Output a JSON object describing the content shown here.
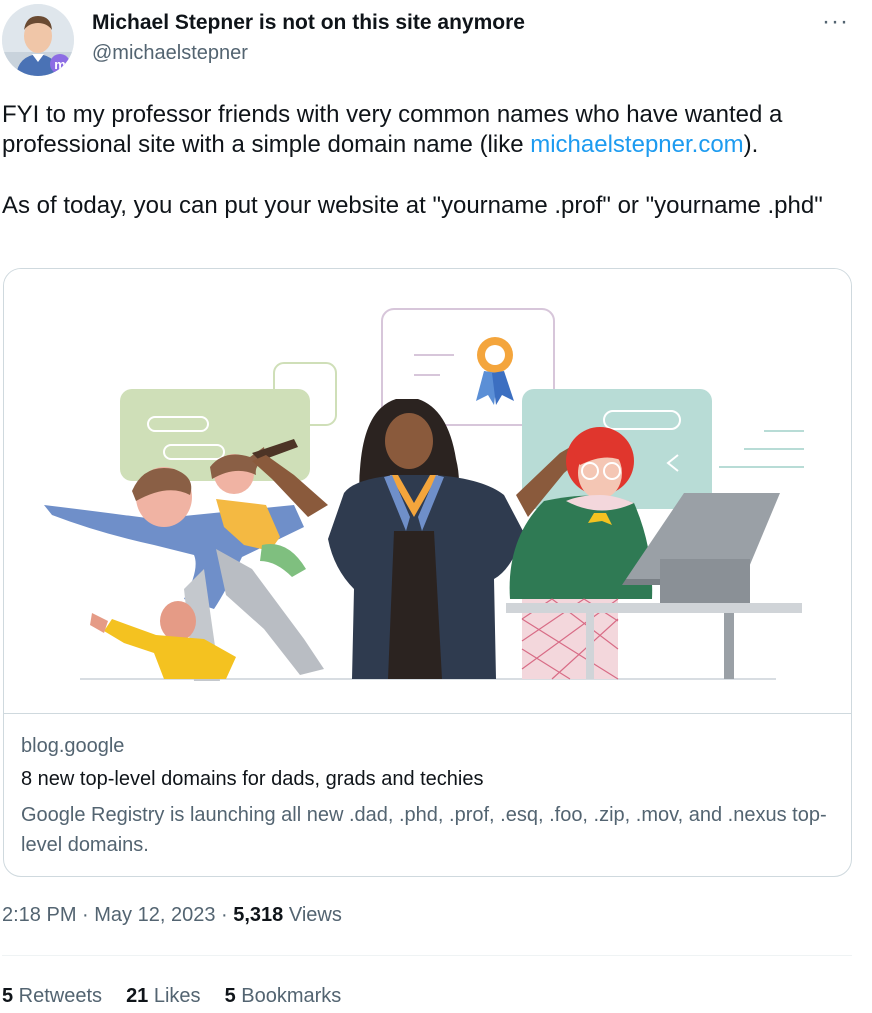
{
  "author": {
    "display_name": "Michael Stepner is not on this site anymore",
    "handle": "@michaelstepner",
    "avatar_icon": "profile-photo-with-mastodon-badge"
  },
  "menu_icon": "more-horizontal-icon",
  "tweet": {
    "line1_prefix": "FYI to my professor friends with very common names who have wanted a professional site with a simple domain name (like ",
    "line1_link": "michaelstepner.com",
    "line1_suffix": ").",
    "line2": "As of today, you can put your website at \"yourname .prof\" or \"yourname .phd\""
  },
  "card": {
    "domain": "blog.google",
    "title": "8 new top-level domains for dads, grads and techies",
    "description": "Google Registry is launching all new .dad, .phd, .prof, .esq, .foo, .zip, .mov, and .nexus top-level domains.",
    "image_icon": "illustration-dad-grad-techie"
  },
  "meta": {
    "time": "2:18 PM",
    "sep1": " · ",
    "date": "May 12, 2023",
    "sep2": " · ",
    "views_count": "5,318",
    "views_label": " Views"
  },
  "stats": {
    "retweets_count": "5",
    "retweets_label": " Retweets",
    "likes_count": "21",
    "likes_label": " Likes",
    "bookmarks_count": "5",
    "bookmarks_label": " Bookmarks"
  },
  "colors": {
    "link": "#1d9bf0",
    "secondary_text": "#536471",
    "primary_text": "#0f1419",
    "border": "#cfd9de"
  }
}
